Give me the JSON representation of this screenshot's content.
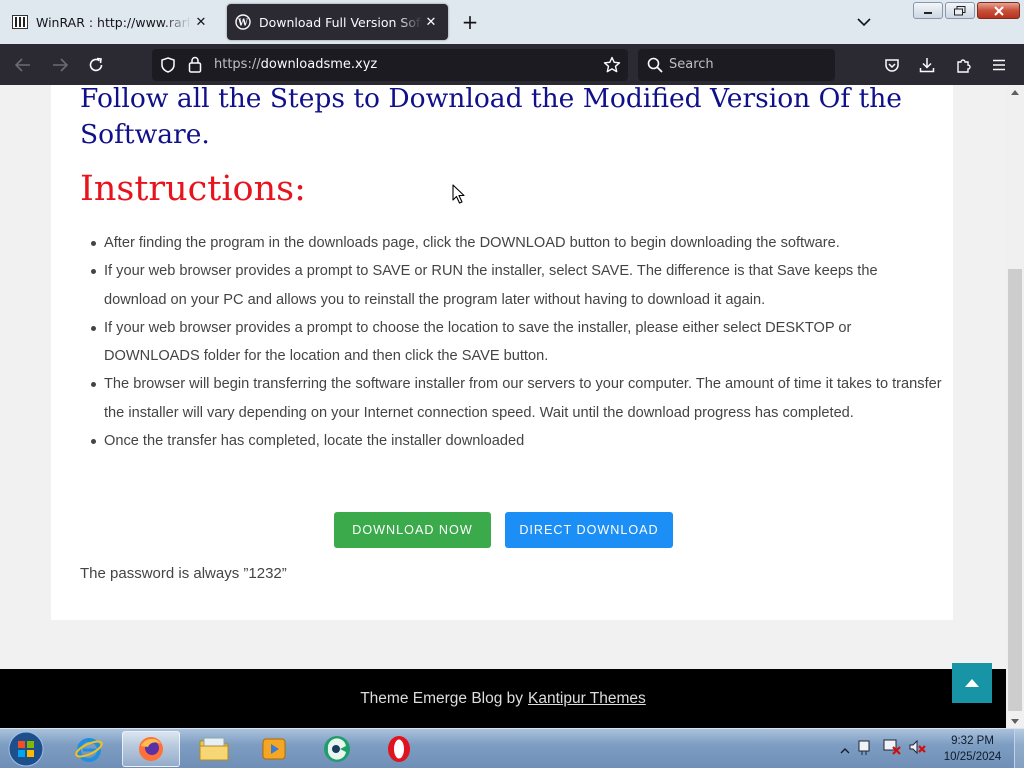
{
  "browser": {
    "tabs": [
      {
        "title": "WinRAR : http://www.rarlab.com",
        "icon": "winrar-icon",
        "active": false
      },
      {
        "title": "Download Full Version Software",
        "icon": "wordpress-icon",
        "active": true
      }
    ],
    "url_prefix": "https://",
    "url_host": "downloadsme.xyz",
    "search_placeholder": "Search"
  },
  "page": {
    "heading": "Follow all the Steps to Download the Modified Version Of the Software.",
    "instructions_title": "Instructions:",
    "steps": [
      "After finding the program in the downloads page, click the DOWNLOAD button to begin downloading the software.",
      "If your web browser provides a prompt to SAVE or RUN the installer, select SAVE. The difference is that Save keeps the download on your PC and allows you to reinstall the program later without having to download it again.",
      "If your web browser provides a prompt to choose the location to save the installer, please either select DESKTOP or DOWNLOADS folder for the location and then click the SAVE button.",
      "The browser will begin transferring the software installer from our servers to your computer. The amount of time it takes to transfer the installer will vary depending on your Internet connection speed. Wait until the download progress has completed.",
      "Once the transfer has completed, locate the installer downloaded"
    ],
    "download_now_label": "DOWNLOAD NOW",
    "direct_download_label": "DIRECT DOWNLOAD",
    "password_note": "The password is always ”1232”",
    "footer_text": "Theme Emerge Blog by",
    "footer_link": "Kantipur Themes",
    "colors": {
      "heading": "#10108a",
      "instructions": "#e8141d",
      "green_button": "#3aaa4b",
      "blue_button": "#1b8ff5",
      "to_top": "#1794a5"
    }
  },
  "taskbar": {
    "time": "9:32 PM",
    "date": "10/25/2024",
    "apps": [
      "internet-explorer-icon",
      "firefox-icon",
      "file-explorer-icon",
      "media-player-icon",
      "app-icon",
      "opera-icon"
    ]
  }
}
